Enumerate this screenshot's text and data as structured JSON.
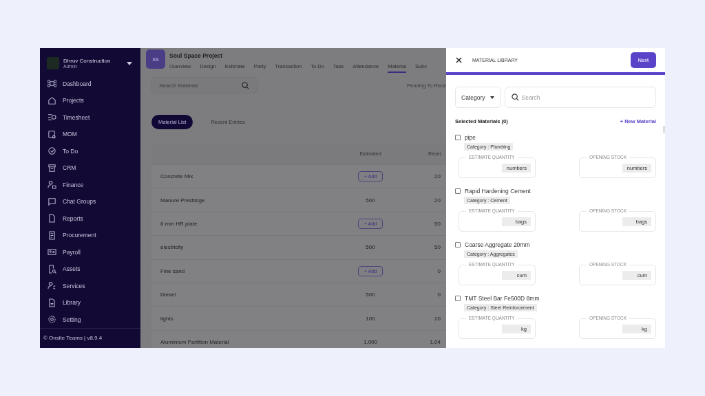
{
  "sidebar": {
    "company": "Dhruv Construction",
    "role": "Admin",
    "items": [
      {
        "label": "Dashboard"
      },
      {
        "label": "Projects"
      },
      {
        "label": "Timesheet"
      },
      {
        "label": "MOM"
      },
      {
        "label": "To Do"
      },
      {
        "label": "CRM"
      },
      {
        "label": "Finance"
      },
      {
        "label": "Chat Groups"
      },
      {
        "label": "Reports"
      },
      {
        "label": "Procurement"
      },
      {
        "label": "Payroll"
      },
      {
        "label": "Assets"
      },
      {
        "label": "Services"
      },
      {
        "label": "Library"
      },
      {
        "label": "Setting"
      }
    ],
    "footer": "© Onsite Teams | v8.9.4"
  },
  "project": {
    "initials": "SS",
    "name": "Soul Space Project",
    "tabs": [
      {
        "label": "Overview",
        "selected": false
      },
      {
        "label": "Design",
        "selected": false
      },
      {
        "label": "Estimate",
        "selected": false
      },
      {
        "label": "Party",
        "selected": false
      },
      {
        "label": "Transaction",
        "selected": false
      },
      {
        "label": "To Do",
        "selected": false
      },
      {
        "label": "Task",
        "selected": false
      },
      {
        "label": "Attendance",
        "selected": false
      },
      {
        "label": "Material",
        "selected": true
      },
      {
        "label": "Subc",
        "selected": false
      }
    ]
  },
  "search": {
    "placeholder": "Search Material"
  },
  "pending_label": "Pending To Rece",
  "view_toggle": [
    {
      "label": "Material List",
      "selected": true
    },
    {
      "label": "Recent Entries",
      "selected": false
    }
  ],
  "table": {
    "columns": [
      "Estimated",
      "Recei"
    ],
    "rows": [
      {
        "name": "Concrete Mix",
        "kind": "add",
        "estimated": "+ Add",
        "received": "20"
      },
      {
        "name": "Manure Prestisige",
        "kind": "value",
        "estimated": "500",
        "received": "20"
      },
      {
        "name": "6 mm HR plate",
        "kind": "add",
        "estimated": "+ Add",
        "received": "50"
      },
      {
        "name": "electricity",
        "kind": "value",
        "estimated": "500",
        "received": "50"
      },
      {
        "name": "Fine sand",
        "kind": "add",
        "estimated": "+ Add",
        "received": "0"
      },
      {
        "name": "Diesel",
        "kind": "value",
        "estimated": "500",
        "received": "0"
      },
      {
        "name": "lights",
        "kind": "value",
        "estimated": "100",
        "received": "20"
      },
      {
        "name": "Aluminium Partition Material",
        "kind": "value",
        "estimated": "1,000",
        "received": "1,04"
      }
    ]
  },
  "drawer": {
    "title": "MATERIAL LIBRARY",
    "next": "Next",
    "category": "Category",
    "search_placeholder": "Search",
    "selected_label": "Selected Materials (0)",
    "new_material": "+ New Material",
    "materials": [
      {
        "name": "pipe",
        "checked": false,
        "category": "Category : Plumbing",
        "fields": [
          {
            "label": "ESTIMATE QUANTITY",
            "unit": "numbers"
          },
          {
            "label": "OPENING STOCK",
            "unit": "numbers"
          }
        ]
      },
      {
        "name": "Rapid Hardening Cement",
        "checked": false,
        "category": "Category : Cement",
        "fields": [
          {
            "label": "ESTIMATE QUANTITY",
            "unit": "bags"
          },
          {
            "label": "OPENING STOCK",
            "unit": "bags"
          }
        ]
      },
      {
        "name": "Coarse Aggregate 20mm",
        "checked": false,
        "category": "Category : Aggregates",
        "fields": [
          {
            "label": "ESTIMATE QUANTITY",
            "unit": "cum"
          },
          {
            "label": "OPENING STOCK",
            "unit": "cum"
          }
        ]
      },
      {
        "name": "TMT Steel Bar Fe500D 8mm",
        "checked": false,
        "category": "Category : Steel Reinforcement",
        "fields": [
          {
            "label": "ESTIMATE QUANTITY",
            "unit": "kg"
          },
          {
            "label": "OPENING STOCK",
            "unit": "kg"
          }
        ]
      }
    ]
  }
}
